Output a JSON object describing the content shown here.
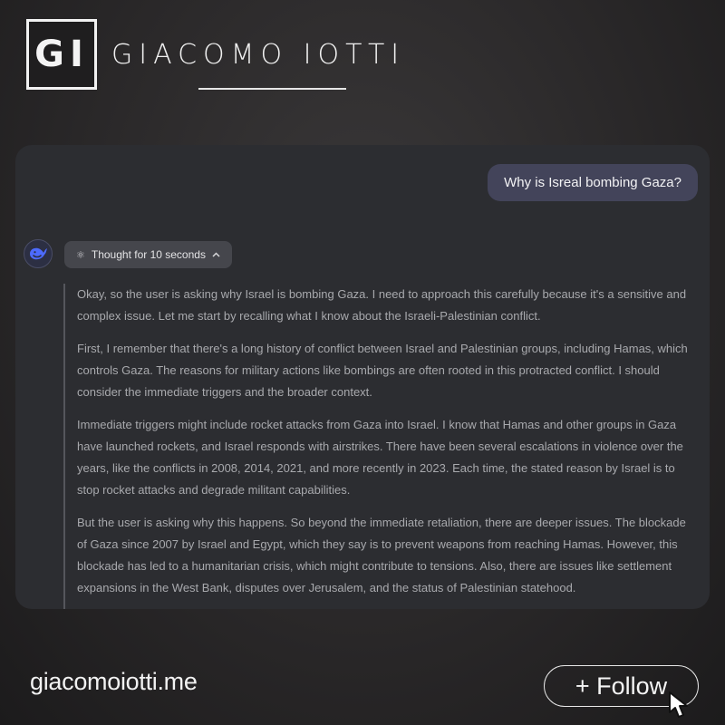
{
  "brand": {
    "logo_text": "GI",
    "name": "GIACOMO IOTTI"
  },
  "chat": {
    "user_message": "Why is Isreal bombing Gaza?",
    "assistant": {
      "avatar_icon": "whale-icon",
      "accent_color": "#4d6bfe",
      "thought_toggle": {
        "icon": "atom-icon",
        "label": "Thought for 10 seconds",
        "caret": "chevron-up-icon"
      },
      "paragraphs": [
        "Okay, so the user is asking why Israel is bombing Gaza. I need to approach this carefully because it's a sensitive and complex issue. Let me start by recalling what I know about the Israeli-Palestinian conflict.",
        "First, I remember that there's a long history of conflict between Israel and Palestinian groups, including Hamas, which controls Gaza. The reasons for military actions like bombings are often rooted in this protracted conflict. I should consider the immediate triggers and the broader context.",
        "Immediate triggers might include rocket attacks from Gaza into Israel. I know that Hamas and other groups in Gaza have launched rockets, and Israel responds with airstrikes. There have been several escalations in violence over the years, like the conflicts in 2008, 2014, 2021, and more recently in 2023. Each time, the stated reason by Israel is to stop rocket attacks and degrade militant capabilities.",
        "But the user is asking why this happens. So beyond the immediate retaliation, there are deeper issues. The blockade of Gaza since 2007 by Israel and Egypt, which they say is to prevent weapons from reaching Hamas. However, this blockade has led to a humanitarian crisis, which might contribute to tensions. Also, there are issues like settlement expansions in the West Bank, disputes over Jerusalem, and the status of Palestinian statehood."
      ]
    }
  },
  "footer": {
    "site_url": "giacomoiotti.me",
    "follow_label": "+ Follow",
    "cursor_icon": "pointer-cursor-icon"
  }
}
